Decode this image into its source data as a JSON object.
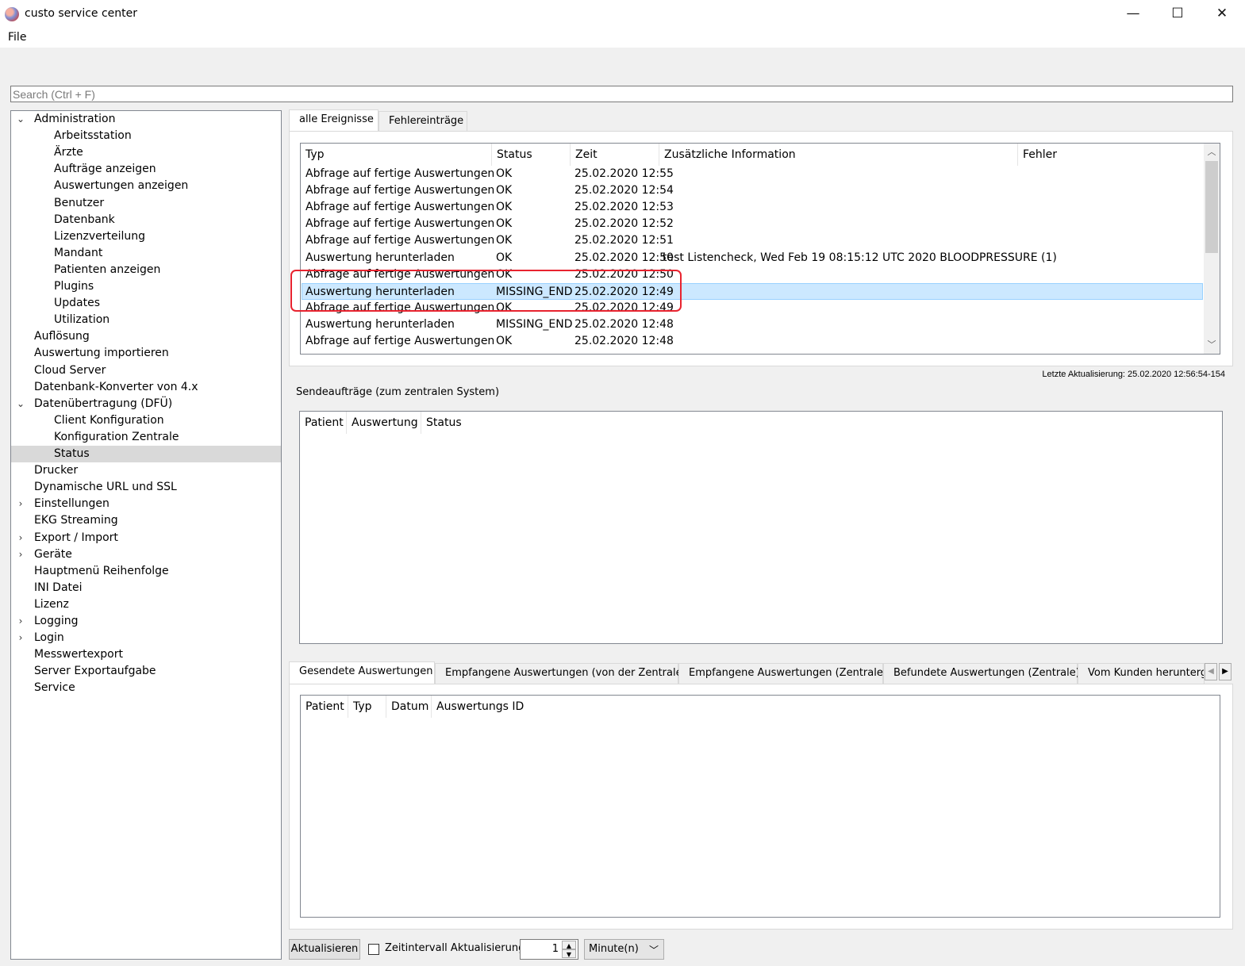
{
  "window": {
    "title": "custo service center",
    "minimize": "—",
    "maximize": "☐",
    "close": "✕"
  },
  "menu": {
    "file": "File"
  },
  "search": {
    "placeholder": "Search (Ctrl + F)"
  },
  "tree": [
    {
      "label": "Administration",
      "level": 0,
      "expander": "expanded"
    },
    {
      "label": "Arbeitsstation",
      "level": 1
    },
    {
      "label": "Ärzte",
      "level": 1
    },
    {
      "label": "Aufträge anzeigen",
      "level": 1
    },
    {
      "label": "Auswertungen anzeigen",
      "level": 1
    },
    {
      "label": "Benutzer",
      "level": 1
    },
    {
      "label": "Datenbank",
      "level": 1
    },
    {
      "label": "Lizenzverteilung",
      "level": 1
    },
    {
      "label": "Mandant",
      "level": 1
    },
    {
      "label": "Patienten anzeigen",
      "level": 1
    },
    {
      "label": "Plugins",
      "level": 1
    },
    {
      "label": "Updates",
      "level": 1
    },
    {
      "label": "Utilization",
      "level": 1
    },
    {
      "label": "Auflösung",
      "level": 0
    },
    {
      "label": "Auswertung importieren",
      "level": 0
    },
    {
      "label": "Cloud Server",
      "level": 0
    },
    {
      "label": "Datenbank-Konverter von 4.x",
      "level": 0
    },
    {
      "label": "Datenübertragung (DFÜ)",
      "level": 0,
      "expander": "expanded"
    },
    {
      "label": "Client Konfiguration",
      "level": 1
    },
    {
      "label": "Konfiguration Zentrale",
      "level": 1
    },
    {
      "label": "Status",
      "level": 1,
      "selected": true
    },
    {
      "label": "Drucker",
      "level": 0
    },
    {
      "label": "Dynamische URL und SSL",
      "level": 0
    },
    {
      "label": "Einstellungen",
      "level": 0,
      "expander": "collapsed"
    },
    {
      "label": "EKG Streaming",
      "level": 0
    },
    {
      "label": "Export / Import",
      "level": 0,
      "expander": "collapsed"
    },
    {
      "label": "Geräte",
      "level": 0,
      "expander": "collapsed"
    },
    {
      "label": "Hauptmenü Reihenfolge",
      "level": 0
    },
    {
      "label": "INI Datei",
      "level": 0
    },
    {
      "label": "Lizenz",
      "level": 0
    },
    {
      "label": "Logging",
      "level": 0,
      "expander": "collapsed"
    },
    {
      "label": "Login",
      "level": 0,
      "expander": "collapsed"
    },
    {
      "label": "Messwertexport",
      "level": 0
    },
    {
      "label": "Server Exportaufgabe",
      "level": 0
    },
    {
      "label": "Service",
      "level": 0
    }
  ],
  "events": {
    "tabs": [
      "alle Ereignisse",
      "Fehlereinträge"
    ],
    "columns": [
      "Typ",
      "Status",
      "Zeit",
      "Zusätzliche Information",
      "Fehler"
    ],
    "rows": [
      {
        "typ": "Abfrage auf fertige Auswertungen",
        "status": "OK",
        "zeit": "25.02.2020 12:55",
        "info": "",
        "fehler": ""
      },
      {
        "typ": "Abfrage auf fertige Auswertungen",
        "status": "OK",
        "zeit": "25.02.2020 12:54",
        "info": "",
        "fehler": ""
      },
      {
        "typ": "Abfrage auf fertige Auswertungen",
        "status": "OK",
        "zeit": "25.02.2020 12:53",
        "info": "",
        "fehler": ""
      },
      {
        "typ": "Abfrage auf fertige Auswertungen",
        "status": "OK",
        "zeit": "25.02.2020 12:52",
        "info": "",
        "fehler": ""
      },
      {
        "typ": "Abfrage auf fertige Auswertungen",
        "status": "OK",
        "zeit": "25.02.2020 12:51",
        "info": "",
        "fehler": ""
      },
      {
        "typ": "Auswertung herunterladen",
        "status": "OK",
        "zeit": "25.02.2020 12:50",
        "info": "test Listencheck, Wed Feb 19 08:15:12 UTC 2020 BLOODPRESSURE (1)",
        "fehler": ""
      },
      {
        "typ": "Abfrage auf fertige Auswertungen",
        "status": "OK",
        "zeit": "25.02.2020 12:50",
        "info": "",
        "fehler": ""
      },
      {
        "typ": "Auswertung herunterladen",
        "status": "MISSING_END",
        "zeit": "25.02.2020 12:49",
        "info": "",
        "fehler": "",
        "selected": true
      },
      {
        "typ": "Abfrage auf fertige Auswertungen",
        "status": "OK",
        "zeit": "25.02.2020 12:49",
        "info": "",
        "fehler": ""
      },
      {
        "typ": "Auswertung herunterladen",
        "status": "MISSING_END",
        "zeit": "25.02.2020 12:48",
        "info": "",
        "fehler": ""
      },
      {
        "typ": "Abfrage auf fertige Auswertungen",
        "status": "OK",
        "zeit": "25.02.2020 12:48",
        "info": "",
        "fehler": ""
      }
    ],
    "last_update": "Letzte Aktualisierung: 25.02.2020 12:56:54-154"
  },
  "send_jobs": {
    "title": "Sendeaufträge (zum zentralen System)",
    "columns": [
      "Patient",
      "Auswertung",
      "Status"
    ]
  },
  "evaluations": {
    "tabs": [
      "Gesendete Auswertungen",
      "Empfangene Auswertungen (von der Zentrale)",
      "Empfangene Auswertungen (Zentrale)",
      "Befundete Auswertungen (Zentrale)",
      "Vom Kunden heruntergel"
    ],
    "columns": [
      "Patient",
      "Typ",
      "Datum",
      "Auswertungs ID"
    ]
  },
  "bottom": {
    "refresh_button": "Aktualisieren",
    "interval_checkbox_label": "Zeitintervall Aktualisierung",
    "interval_checked": false,
    "interval_value": "1",
    "interval_unit": "Minute(n)"
  }
}
